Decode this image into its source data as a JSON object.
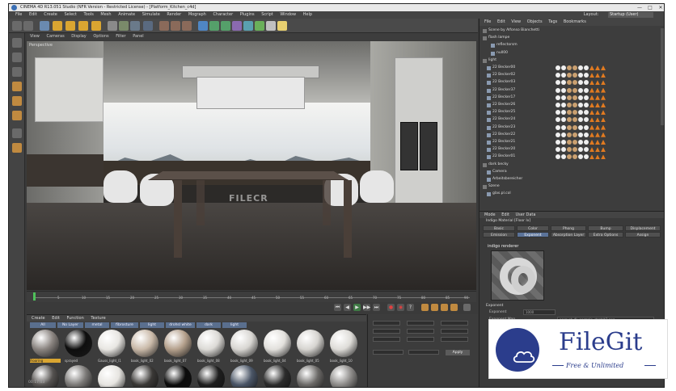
{
  "window": {
    "title": "CINEMA 4D R13.051 Studio (NFR Version - Restricted License) - [Platform_Kitchen_c4d]",
    "min": "—",
    "max": "□",
    "close": "✕"
  },
  "menubar": {
    "items": [
      "File",
      "Edit",
      "Create",
      "Select",
      "Tools",
      "Mesh",
      "Animate",
      "Simulate",
      "Render",
      "Mograph",
      "Character",
      "Plugins",
      "Script",
      "Window",
      "Help"
    ],
    "layout_label": "Layout:",
    "layout_value": "Startup (User)"
  },
  "viewport": {
    "menu": [
      "View",
      "Cameras",
      "Display",
      "Options",
      "Filter",
      "Panel"
    ],
    "label": "Perspective",
    "watermark": "FILECR"
  },
  "timeline": {
    "ticks": [
      "0",
      "5",
      "10",
      "15",
      "20",
      "25",
      "30",
      "35",
      "40",
      "45",
      "50",
      "55",
      "60",
      "65",
      "70",
      "75",
      "80",
      "85",
      "90"
    ]
  },
  "playback": {
    "buttons": [
      "⏮",
      "◀",
      "▶",
      "▶▶",
      "⏭",
      "●",
      "◉",
      "?"
    ]
  },
  "material_manager": {
    "menu": [
      "Create",
      "Edit",
      "Function",
      "Texture"
    ],
    "filters": [
      "All",
      "No Layer",
      "metal",
      "fibrosture",
      "light",
      "drohsl white",
      "dark",
      "light"
    ],
    "row1_labels": [
      "Flooring",
      "sprayed",
      "Gauss_light_l1",
      "book_light_02",
      "book_light_07",
      "book_light_08",
      "book_light_09",
      "book_light_04",
      "book_light_05",
      "book_light_10"
    ],
    "row1_colors": [
      "#8a8480",
      "#0e0e0e",
      "#e8e6e2",
      "#c9b9a8",
      "#b4a08c",
      "#dcdad6",
      "#d8d6d2",
      "#e2e0dc",
      "#d6d4d0",
      "#dedcd8"
    ],
    "row2_colors": [
      "#555250",
      "#7a7876",
      "#e6e4e0",
      "#3a3836",
      "#0c0c0c",
      "#1e1e1e",
      "#4a5566",
      "#2c2c2c",
      "#6a6866",
      "#8c8a88"
    ]
  },
  "coord_panel": {
    "apply": "Apply"
  },
  "object_manager": {
    "menu": [
      "File",
      "Edit",
      "View",
      "Objects",
      "Tags",
      "Bookmarks"
    ],
    "rows": [
      {
        "name": "Scene by Alfonso Bianchetti",
        "indent": 0
      },
      {
        "name": "flash lampe",
        "indent": 0
      },
      {
        "name": "reflectorsm",
        "indent": 2
      },
      {
        "name": "null00",
        "indent": 2
      },
      {
        "name": "light",
        "indent": 0
      },
      {
        "name": "22 Becker00",
        "indent": 1
      },
      {
        "name": "22 Becker02",
        "indent": 1
      },
      {
        "name": "22 Becker03",
        "indent": 1
      },
      {
        "name": "22 Becker37",
        "indent": 1
      },
      {
        "name": "22 Becker17",
        "indent": 1
      },
      {
        "name": "22 Becker26",
        "indent": 1
      },
      {
        "name": "22 Becker25",
        "indent": 1
      },
      {
        "name": "22 Becker24",
        "indent": 1
      },
      {
        "name": "22 Becker23",
        "indent": 1
      },
      {
        "name": "22 Becker22",
        "indent": 1
      },
      {
        "name": "22 Becker21",
        "indent": 1
      },
      {
        "name": "22 Becker20",
        "indent": 1
      },
      {
        "name": "22 Becker01",
        "indent": 1
      },
      {
        "name": "dark becky",
        "indent": 0
      },
      {
        "name": "Camera",
        "indent": 1
      },
      {
        "name": "Arbeitsbereicher",
        "indent": 1
      },
      {
        "name": "Szene",
        "indent": 0
      },
      {
        "name": "glas.pl.col",
        "indent": 1
      }
    ]
  },
  "attribute_manager": {
    "menu": [
      "Mode",
      "Edit",
      "User Data"
    ],
    "title": "Indigo Material [Floor Ix]",
    "tabs_row1": [
      "Basic",
      "Color",
      "Phong",
      "Bump",
      "Displacement"
    ],
    "tabs_row2": [
      "Emission",
      "Exponent",
      "Absorption Layer",
      "Extra Options",
      "Assign"
    ],
    "render_label": "indigo renderer",
    "section": "Exponent",
    "exponent_label": "Exponent",
    "exponent_value": "1000",
    "exponent_map_label": "Exponent Map",
    "exponent_map_value": "parquet_dk_normale_stretch2.png"
  },
  "filegit": {
    "title": "FileGit",
    "subtitle": "Free & Unlimited"
  },
  "statusbar": {
    "text": "00:17:03"
  }
}
